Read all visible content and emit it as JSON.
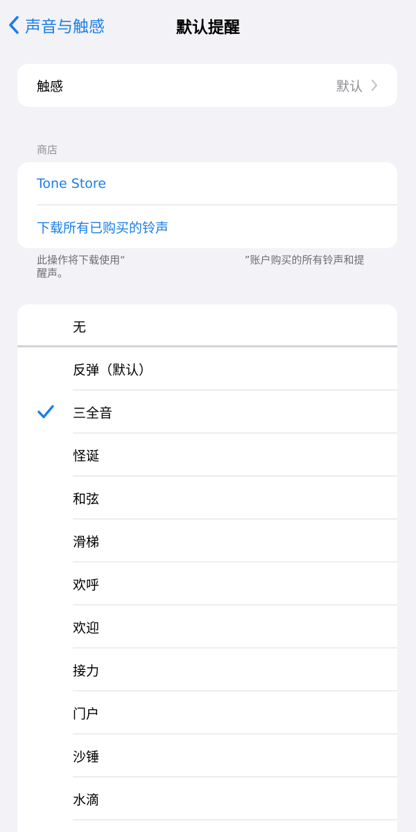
{
  "nav": {
    "back_label": "声音与触感",
    "title": "默认提醒",
    "back_icon": "chevron-left-icon"
  },
  "haptics": {
    "label": "触感",
    "value": "默认",
    "chevron_icon": "chevron-right-icon"
  },
  "store": {
    "section_label": "商店",
    "tone_store": "Tone Store",
    "download_all": "下载所有已购买的铃声",
    "footnote_before": "此操作将下载使用“",
    "footnote_after": "”账户购买的所有铃声和提醒声。"
  },
  "tones": {
    "none": "无",
    "selected_index": 1,
    "check_icon": "checkmark-icon",
    "items": [
      {
        "label": "反弹（默认）"
      },
      {
        "label": "三全音"
      },
      {
        "label": "怪诞"
      },
      {
        "label": "和弦"
      },
      {
        "label": "滑梯"
      },
      {
        "label": "欢呼"
      },
      {
        "label": "欢迎"
      },
      {
        "label": "接力"
      },
      {
        "label": "门户"
      },
      {
        "label": "沙锤"
      },
      {
        "label": "水滴"
      }
    ]
  },
  "colors": {
    "accent": "#1a7ee6",
    "background": "#f2f2f7",
    "secondary_text": "#8e8e93"
  }
}
